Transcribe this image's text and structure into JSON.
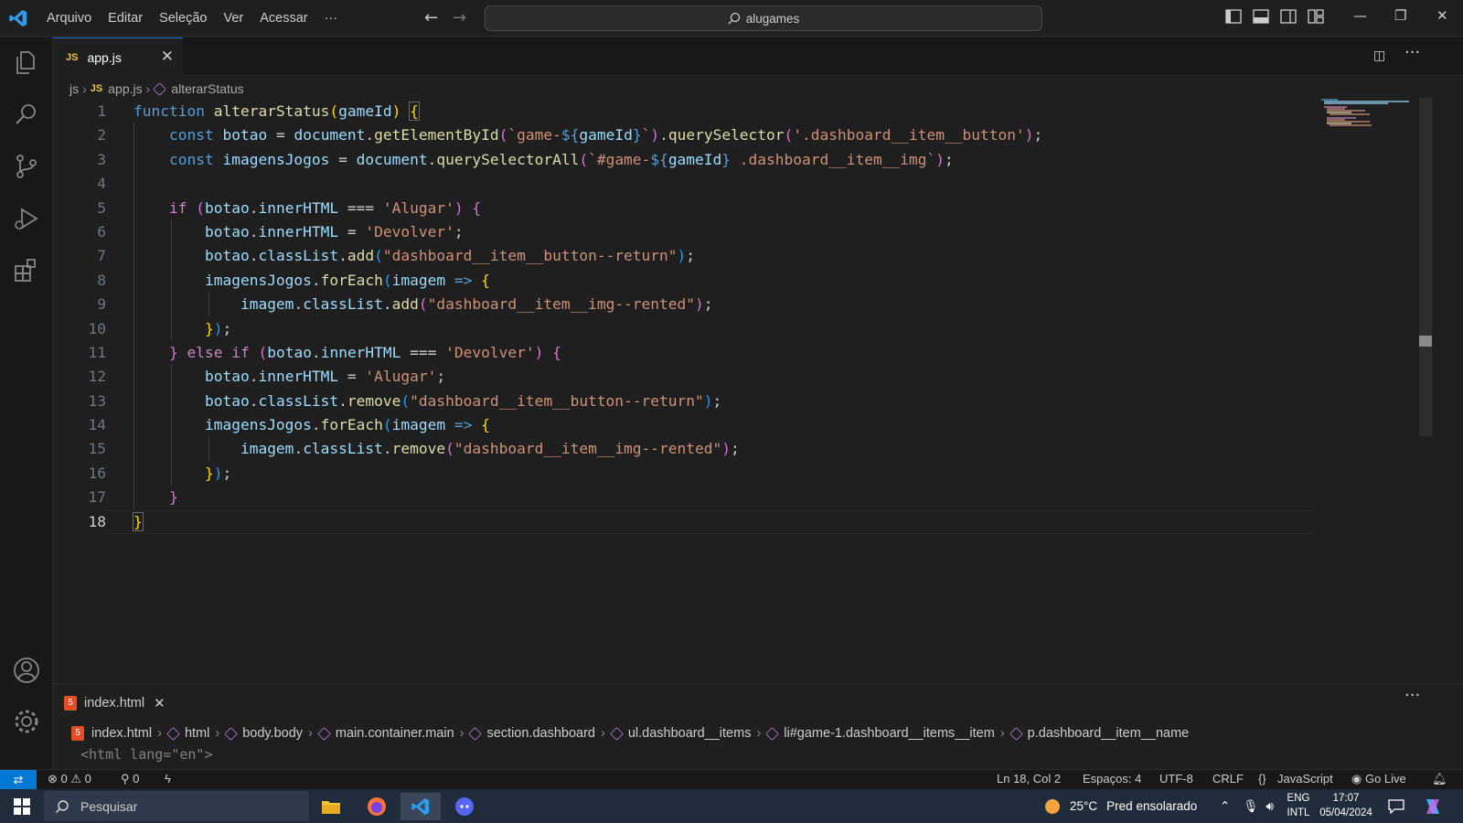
{
  "titlebar": {
    "menu": [
      "Arquivo",
      "Editar",
      "Seleção",
      "Ver",
      "Acessar",
      "···"
    ],
    "search_text": "alugames"
  },
  "editor": {
    "tab_badge": "JS",
    "tab_name": "app.js",
    "breadcrumb": [
      "js",
      "app.js",
      "alterarStatus"
    ],
    "line_numbers": [
      "1",
      "2",
      "3",
      "4",
      "5",
      "6",
      "7",
      "8",
      "9",
      "10",
      "11",
      "12",
      "13",
      "14",
      "15",
      "16",
      "17",
      "18"
    ]
  },
  "panel": {
    "tab_name": "index.html",
    "breadcrumb": [
      "index.html",
      "html",
      "body.body",
      "main.container.main",
      "section.dashboard",
      "ul.dashboard__items",
      "li#game-1.dashboard__items__item",
      "p.dashboard__item__name"
    ],
    "code_peek": "<html lang=\"en\">"
  },
  "statusbar": {
    "errors": "0",
    "warnings": "0",
    "ports": "0",
    "position": "Ln 18, Col 2",
    "spaces": "Espaços: 4",
    "encoding": "UTF-8",
    "eol": "CRLF",
    "language": "JavaScript",
    "golive": "Go Live"
  },
  "taskbar": {
    "search_placeholder": "Pesquisar",
    "weather_temp": "25°C",
    "weather_desc": "Pred ensolarado",
    "lang1": "ENG",
    "lang2": "INTL",
    "time": "17:07",
    "date": "05/04/2024"
  },
  "colors": {
    "accent": "#0078d4",
    "keyword": "#569cd6",
    "control": "#c586c0",
    "function": "#dcdcaa",
    "variable": "#9cdcfe",
    "string": "#ce9178"
  }
}
